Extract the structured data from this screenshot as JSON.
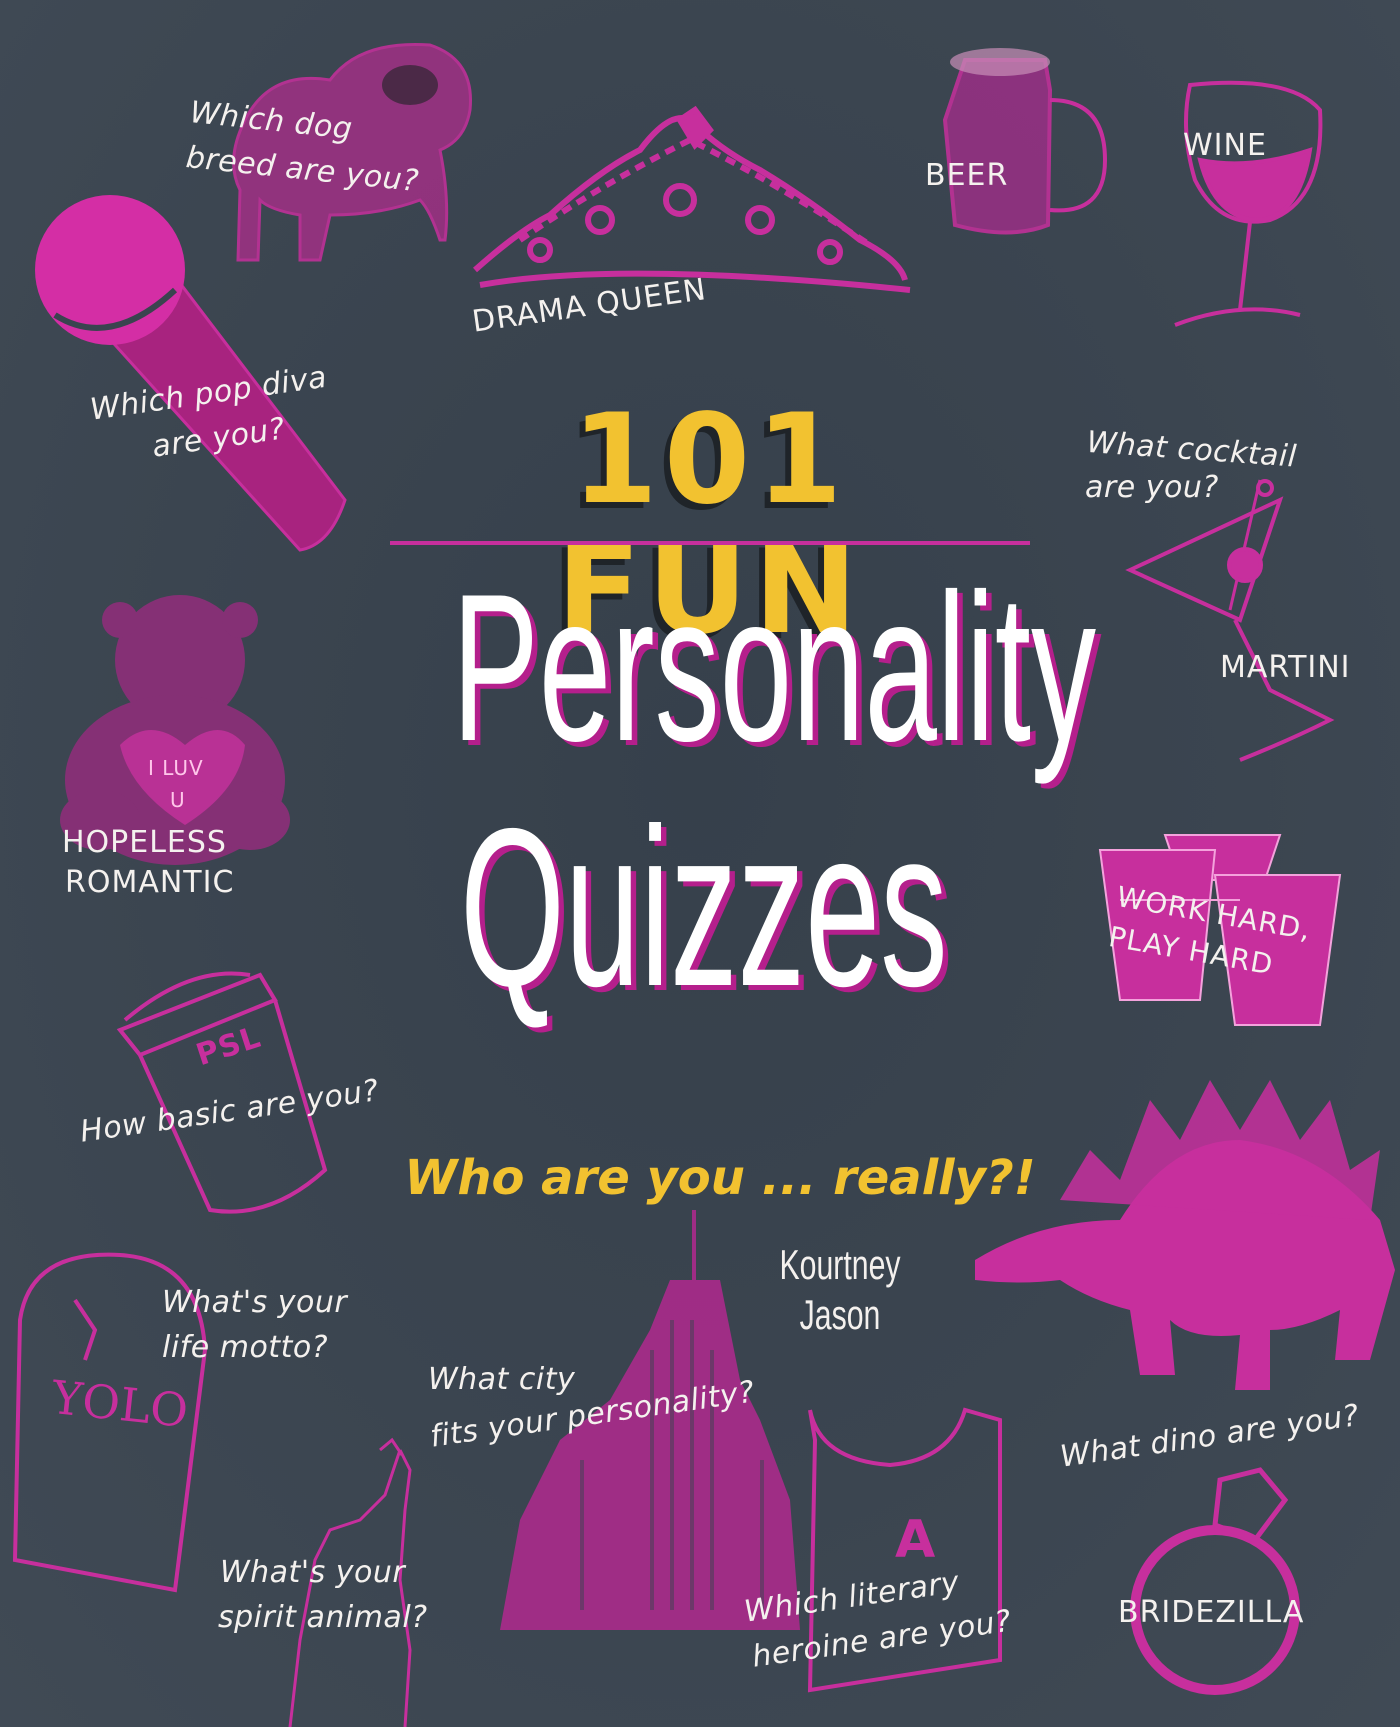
{
  "colors": {
    "background": "#3a444f",
    "accent_pink": "#c72f9d",
    "accent_yellow": "#f2c230",
    "text_light": "#f4f1ee"
  },
  "cover": {
    "title_top": "101 FUN",
    "title_main": "Personality",
    "title_sub": "Quizzes",
    "tagline": "Who are you ... really?!",
    "author": "Kourtney Jason"
  },
  "labels": {
    "dog_1": "Which dog",
    "dog_2": "breed are you?",
    "drama_queen": "DRAMA QUEEN",
    "beer": "BEER",
    "wine": "WINE",
    "diva_1": "Which pop diva",
    "diva_2": "are you?",
    "cocktail_1": "What cocktail",
    "cocktail_2": "are you?",
    "martini": "MARTINI",
    "romantic_1": "HOPELESS",
    "romantic_2": "ROMANTIC",
    "heart_1": "I LUV",
    "heart_2": "U",
    "work_1": "WORK HARD,",
    "work_2": "PLAY HARD",
    "psl": "PSL",
    "basic": "How basic are you?",
    "motto_1": "What's your",
    "motto_2": "life motto?",
    "yolo": "YOLO",
    "city_1": "What city",
    "city_2": "fits your personality?",
    "dino": "What dino are you?",
    "spirit_1": "What's your",
    "spirit_2": "spirit animal?",
    "tank_letter": "A",
    "heroine_1": "Which literary",
    "heroine_2": "heroine are you?",
    "bridezilla": "BRIDEZILLA"
  },
  "icons": [
    "pug-icon",
    "tiara-icon",
    "beer-mug-icon",
    "wine-glass-icon",
    "microphone-icon",
    "martini-glass-icon",
    "teddy-bear-icon",
    "red-cups-icon",
    "coffee-cup-icon",
    "tombstone-icon",
    "skyscraper-icon",
    "stegosaurus-icon",
    "wolf-icon",
    "tank-top-icon",
    "diamond-ring-icon"
  ]
}
